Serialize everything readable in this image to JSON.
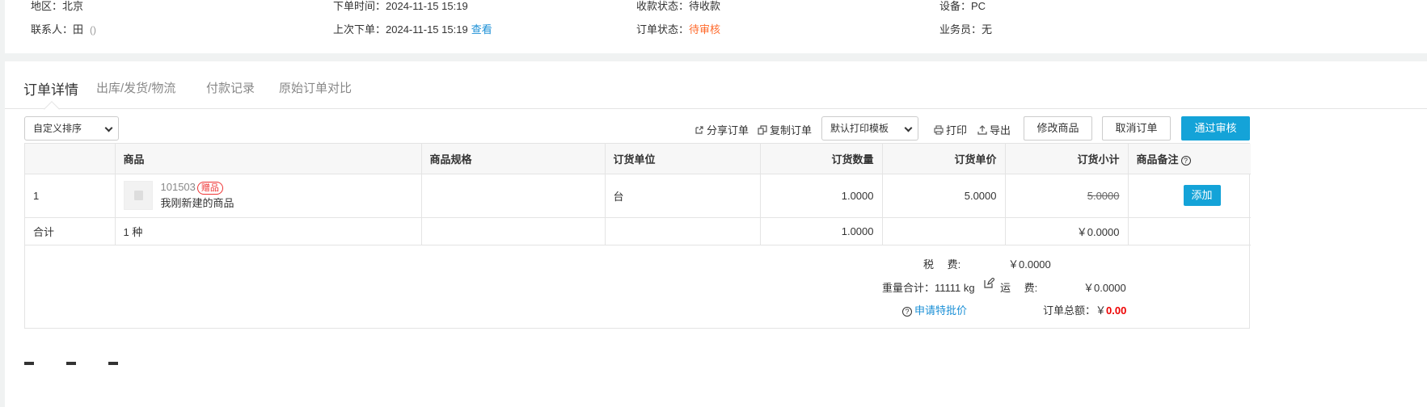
{
  "info": {
    "region_label": "地区：北京",
    "order_time_label": "下单时间：2024-11-15 15:19",
    "payment_status_label": "收款状态：待收款",
    "device_label": "设备：PC",
    "contact_label": "联系人：田",
    "contact_extra": "()",
    "last_order_label": "上次下单：2024-11-15 15:19",
    "last_order_link": "查看",
    "order_status_prefix": "订单状态：",
    "order_status_value": "待审核",
    "salesperson_label": "业务员：无"
  },
  "tabs": [
    {
      "label": "订单详情"
    },
    {
      "label": "出库/发货/物流"
    },
    {
      "label": "付款记录"
    },
    {
      "label": "原始订单对比"
    }
  ],
  "toolbar": {
    "sort_select": "自定义排序",
    "share_order": "分享订单",
    "copy_order": "复制订单",
    "print_template": "默认打印模板",
    "print": "打印",
    "export": "导出",
    "edit_goods": "修改商品",
    "cancel_order": "取消订单",
    "approve": "通过审核"
  },
  "table": {
    "headers": [
      "",
      "商品",
      "商品规格",
      "订货单位",
      "订货数量",
      "订货单价",
      "订货小计",
      "商品备注"
    ],
    "help_icon": "?",
    "row": {
      "index": "1",
      "code": "101503",
      "gift_badge": "赠品",
      "name": "我刚新建的商品",
      "spec": "",
      "unit": "台",
      "qty": "1.0000",
      "price": "5.0000",
      "subtotal": "5.0000",
      "add_button": "添加"
    },
    "sum_row": {
      "label": "合计",
      "kinds": "1 种",
      "qty": "1.0000",
      "subtotal": "￥0.0000"
    }
  },
  "totals": {
    "tax_label": "税　 费:",
    "tax_value": "￥0.0000",
    "weight_label": "重量合计：11111 kg",
    "freight_label": "运　 费:",
    "freight_value": "￥0.0000",
    "special_price_link": "申请特批价",
    "order_total_label": "订单总额：￥",
    "order_total_value": "0.00"
  },
  "colors": {
    "primary": "#14a3d8",
    "warn": "#ff6a2b",
    "link": "#1a8fd6",
    "total_red": "#e00000"
  }
}
